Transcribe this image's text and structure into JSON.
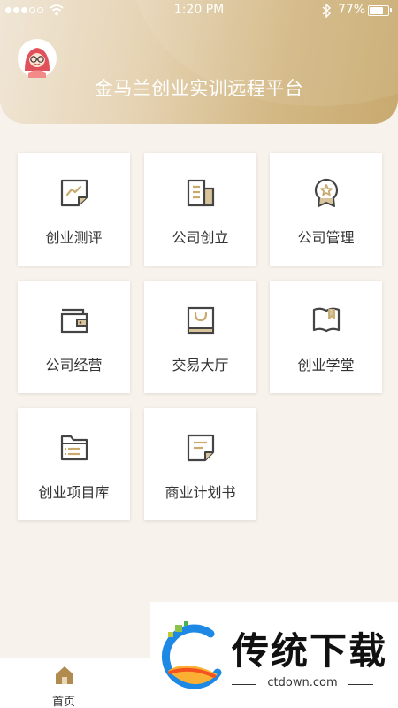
{
  "status_bar": {
    "time": "1:20 PM",
    "battery": "77%"
  },
  "header": {
    "title": "金马兰创业实训远程平台"
  },
  "modules": [
    {
      "label": "创业测评",
      "icon": "chart-icon"
    },
    {
      "label": "公司创立",
      "icon": "building-icon"
    },
    {
      "label": "公司管理",
      "icon": "badge-icon"
    },
    {
      "label": "公司经营",
      "icon": "wallet-icon"
    },
    {
      "label": "交易大厅",
      "icon": "shopping-bag-icon"
    },
    {
      "label": "创业学堂",
      "icon": "book-icon"
    },
    {
      "label": "创业项目库",
      "icon": "folder-icon"
    },
    {
      "label": "商业计划书",
      "icon": "document-icon"
    }
  ],
  "tabbar": {
    "home_label": "首页"
  },
  "watermark": {
    "name": "传统下载",
    "url": "ctdown.com"
  },
  "colors": {
    "accent": "#c9a96e",
    "icon_stroke": "#444444",
    "background": "#f8f2ec"
  }
}
